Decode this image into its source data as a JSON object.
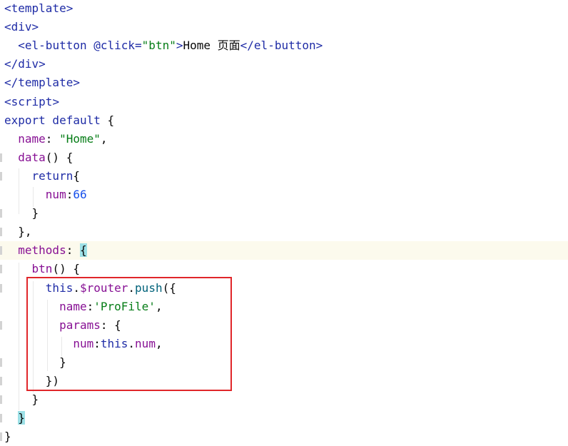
{
  "editor": {
    "lines": [
      {
        "tokens": [
          {
            "t": "<",
            "c": "tag"
          },
          {
            "t": "template",
            "c": "tag"
          },
          {
            "t": ">",
            "c": "tag"
          }
        ]
      },
      {
        "tokens": [
          {
            "t": "<",
            "c": "tag"
          },
          {
            "t": "div",
            "c": "tag"
          },
          {
            "t": ">",
            "c": "tag"
          }
        ]
      },
      {
        "tokens": [
          {
            "t": "  <",
            "c": "tag"
          },
          {
            "t": "el-button",
            "c": "tag"
          },
          {
            "t": " @click=",
            "c": "attr"
          },
          {
            "t": "\"btn\"",
            "c": "str"
          },
          {
            "t": ">",
            "c": "tag"
          },
          {
            "t": "Home 页面",
            "c": "txt"
          },
          {
            "t": "</",
            "c": "tag"
          },
          {
            "t": "el-button",
            "c": "tag"
          },
          {
            "t": ">",
            "c": "tag"
          }
        ]
      },
      {
        "tokens": [
          {
            "t": "</",
            "c": "tag"
          },
          {
            "t": "div",
            "c": "tag"
          },
          {
            "t": ">",
            "c": "tag"
          }
        ]
      },
      {
        "tokens": [
          {
            "t": "</",
            "c": "tag"
          },
          {
            "t": "template",
            "c": "tag"
          },
          {
            "t": ">",
            "c": "tag"
          }
        ]
      },
      {
        "tokens": [
          {
            "t": "<",
            "c": "tag"
          },
          {
            "t": "script",
            "c": "tag"
          },
          {
            "t": ">",
            "c": "tag"
          }
        ]
      },
      {
        "tokens": [
          {
            "t": "export default ",
            "c": "kw"
          },
          {
            "t": "{",
            "c": "txt"
          }
        ]
      },
      {
        "tokens": [
          {
            "t": "  ",
            "c": "txt"
          },
          {
            "t": "name",
            "c": "prop"
          },
          {
            "t": ": ",
            "c": "txt"
          },
          {
            "t": "\"Home\"",
            "c": "str"
          },
          {
            "t": ",",
            "c": "txt"
          }
        ]
      },
      {
        "tokens": [
          {
            "t": "  ",
            "c": "txt"
          },
          {
            "t": "data",
            "c": "prop"
          },
          {
            "t": "() {",
            "c": "txt"
          }
        ],
        "mark": true
      },
      {
        "tokens": [
          {
            "t": "    ",
            "c": "txt"
          },
          {
            "t": "return",
            "c": "kw"
          },
          {
            "t": "{",
            "c": "txt"
          }
        ],
        "mark": true
      },
      {
        "tokens": [
          {
            "t": "      ",
            "c": "txt"
          },
          {
            "t": "num",
            "c": "prop"
          },
          {
            "t": ":",
            "c": "txt"
          },
          {
            "t": "66",
            "c": "num"
          }
        ]
      },
      {
        "tokens": [
          {
            "t": "    }",
            "c": "txt"
          }
        ],
        "mark": true
      },
      {
        "tokens": [
          {
            "t": "  },",
            "c": "txt"
          }
        ],
        "mark": true
      },
      {
        "tokens": [
          {
            "t": "  ",
            "c": "txt"
          },
          {
            "t": "methods",
            "c": "prop"
          },
          {
            "t": ": ",
            "c": "txt"
          },
          {
            "t": "{",
            "c": "brace"
          }
        ],
        "current": true,
        "mark": true
      },
      {
        "tokens": [
          {
            "t": "    ",
            "c": "txt"
          },
          {
            "t": "btn",
            "c": "prop"
          },
          {
            "t": "() {",
            "c": "txt"
          }
        ],
        "mark": true
      },
      {
        "tokens": [
          {
            "t": "      ",
            "c": "txt"
          },
          {
            "t": "this",
            "c": "kw"
          },
          {
            "t": ".",
            "c": "txt"
          },
          {
            "t": "$router",
            "c": "prop"
          },
          {
            "t": ".",
            "c": "txt"
          },
          {
            "t": "push",
            "c": "fn"
          },
          {
            "t": "({",
            "c": "txt"
          }
        ],
        "mark": true
      },
      {
        "tokens": [
          {
            "t": "        ",
            "c": "txt"
          },
          {
            "t": "name",
            "c": "prop"
          },
          {
            "t": ":",
            "c": "txt"
          },
          {
            "t": "'ProFile'",
            "c": "str"
          },
          {
            "t": ",",
            "c": "txt"
          }
        ]
      },
      {
        "tokens": [
          {
            "t": "        ",
            "c": "txt"
          },
          {
            "t": "params",
            "c": "prop"
          },
          {
            "t": ": {",
            "c": "txt"
          }
        ],
        "mark": true
      },
      {
        "tokens": [
          {
            "t": "          ",
            "c": "txt"
          },
          {
            "t": "num",
            "c": "prop"
          },
          {
            "t": ":",
            "c": "txt"
          },
          {
            "t": "this",
            "c": "kw"
          },
          {
            "t": ".",
            "c": "txt"
          },
          {
            "t": "num",
            "c": "prop"
          },
          {
            "t": ",",
            "c": "txt"
          }
        ]
      },
      {
        "tokens": [
          {
            "t": "        }",
            "c": "txt"
          }
        ],
        "mark": true
      },
      {
        "tokens": [
          {
            "t": "      })",
            "c": "txt"
          }
        ],
        "mark": true
      },
      {
        "tokens": [
          {
            "t": "    }",
            "c": "txt"
          }
        ],
        "mark": true
      },
      {
        "tokens": [
          {
            "t": "  ",
            "c": "txt"
          },
          {
            "t": "}",
            "c": "brace"
          }
        ],
        "mark": true
      },
      {
        "tokens": [
          {
            "t": "}",
            "c": "txt"
          }
        ],
        "mark": true
      }
    ]
  },
  "annotation": {
    "color": "#e0262a"
  }
}
